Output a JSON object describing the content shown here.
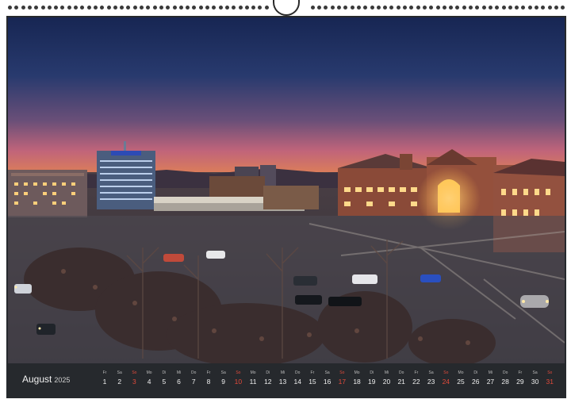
{
  "calendar": {
    "month": "August",
    "year": "2025",
    "days": [
      {
        "wd": "Fr",
        "dn": "1",
        "sun": false
      },
      {
        "wd": "Sa",
        "dn": "2",
        "sun": false
      },
      {
        "wd": "So",
        "dn": "3",
        "sun": true
      },
      {
        "wd": "Mo",
        "dn": "4",
        "sun": false
      },
      {
        "wd": "Di",
        "dn": "5",
        "sun": false
      },
      {
        "wd": "Mi",
        "dn": "6",
        "sun": false
      },
      {
        "wd": "Do",
        "dn": "7",
        "sun": false
      },
      {
        "wd": "Fr",
        "dn": "8",
        "sun": false
      },
      {
        "wd": "Sa",
        "dn": "9",
        "sun": false
      },
      {
        "wd": "So",
        "dn": "10",
        "sun": true
      },
      {
        "wd": "Mo",
        "dn": "11",
        "sun": false
      },
      {
        "wd": "Di",
        "dn": "12",
        "sun": false
      },
      {
        "wd": "Mi",
        "dn": "13",
        "sun": false
      },
      {
        "wd": "Do",
        "dn": "14",
        "sun": false
      },
      {
        "wd": "Fr",
        "dn": "15",
        "sun": false
      },
      {
        "wd": "Sa",
        "dn": "16",
        "sun": false
      },
      {
        "wd": "So",
        "dn": "17",
        "sun": true
      },
      {
        "wd": "Mo",
        "dn": "18",
        "sun": false
      },
      {
        "wd": "Di",
        "dn": "19",
        "sun": false
      },
      {
        "wd": "Mi",
        "dn": "20",
        "sun": false
      },
      {
        "wd": "Do",
        "dn": "21",
        "sun": false
      },
      {
        "wd": "Fr",
        "dn": "22",
        "sun": false
      },
      {
        "wd": "Sa",
        "dn": "23",
        "sun": false
      },
      {
        "wd": "So",
        "dn": "24",
        "sun": true
      },
      {
        "wd": "Mo",
        "dn": "25",
        "sun": false
      },
      {
        "wd": "Di",
        "dn": "26",
        "sun": false
      },
      {
        "wd": "Mi",
        "dn": "27",
        "sun": false
      },
      {
        "wd": "Do",
        "dn": "28",
        "sun": false
      },
      {
        "wd": "Fr",
        "dn": "29",
        "sun": false
      },
      {
        "wd": "Sa",
        "dn": "30",
        "sun": false
      },
      {
        "wd": "So",
        "dn": "31",
        "sun": true
      }
    ]
  },
  "colors": {
    "frame": "#26292d",
    "sunday": "#e24a3b",
    "sky_top": "#1b2a55",
    "sky_horizon": "#e07a45"
  }
}
